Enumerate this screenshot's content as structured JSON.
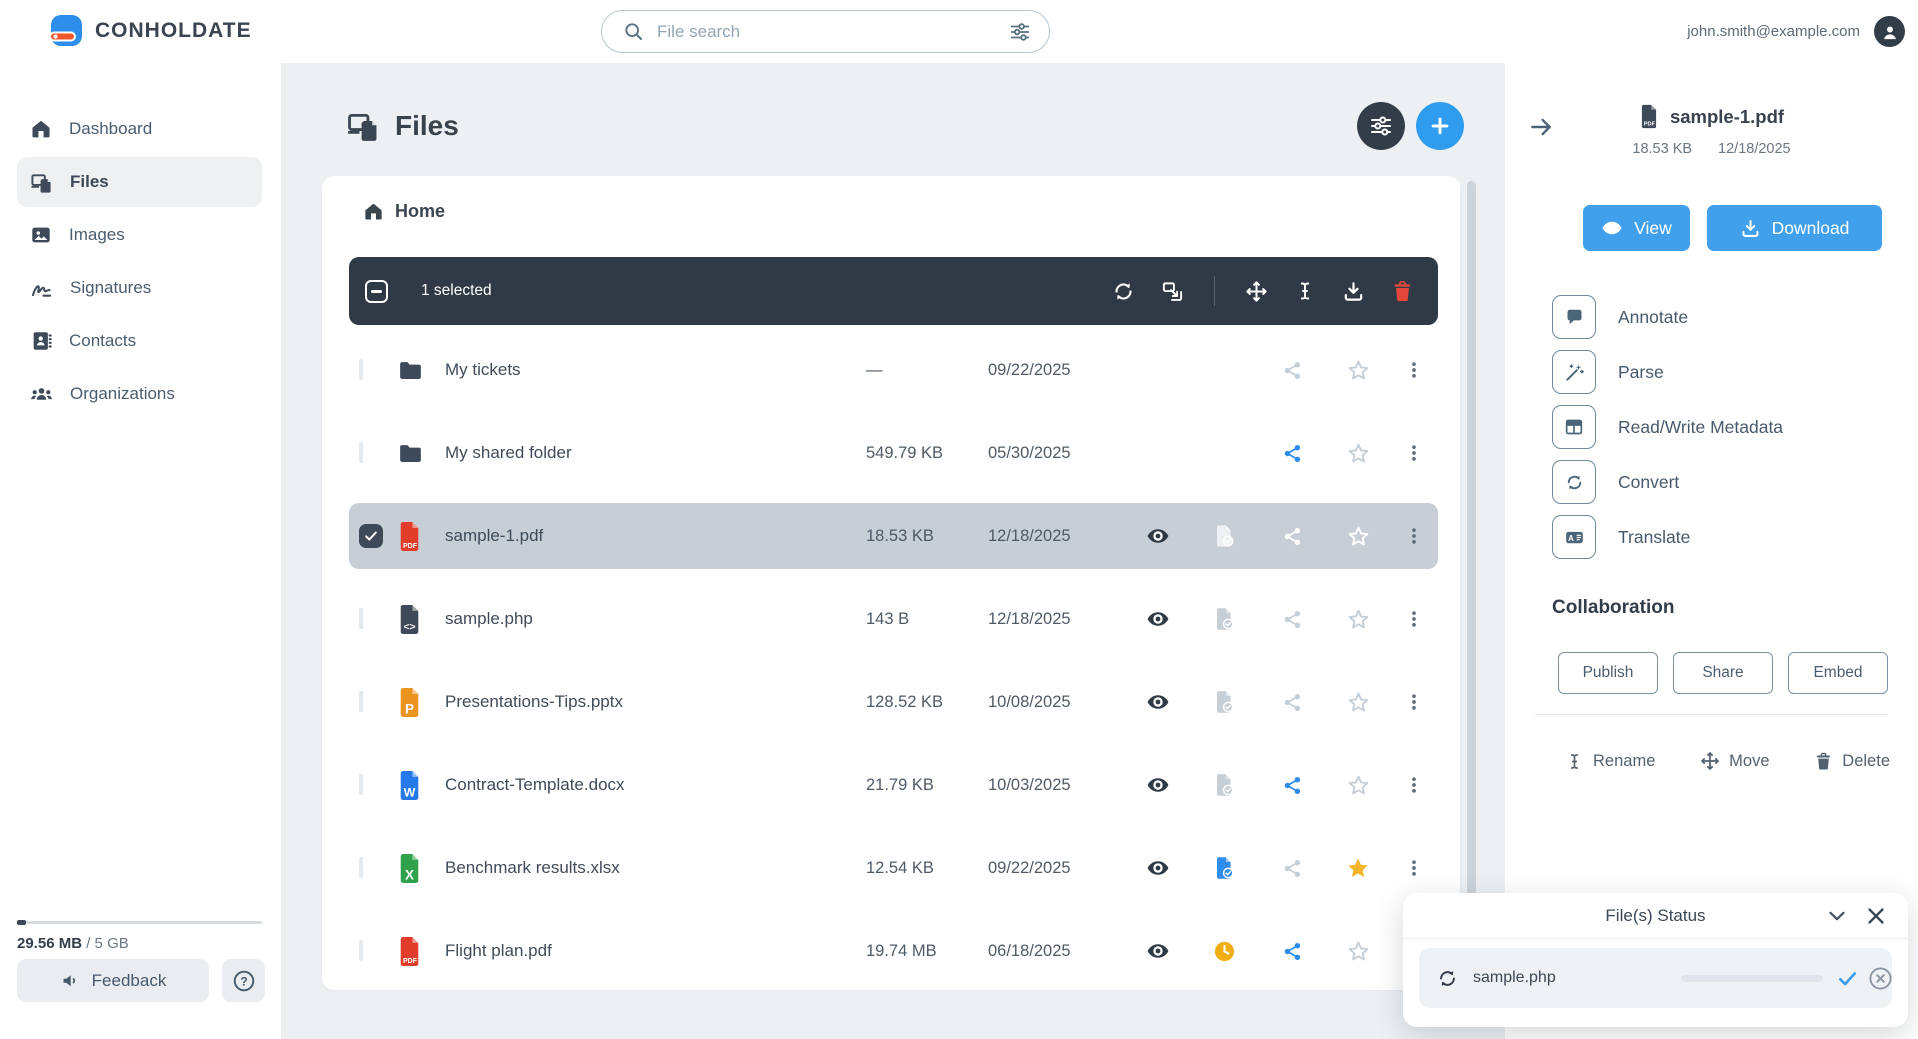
{
  "topbar": {
    "brand": "CONHOLDATE",
    "search_placeholder": "File search",
    "user_email": "john.smith@example.com"
  },
  "sidebar": {
    "items": [
      {
        "label": "Dashboard"
      },
      {
        "label": "Files"
      },
      {
        "label": "Images"
      },
      {
        "label": "Signatures"
      },
      {
        "label": "Contacts"
      },
      {
        "label": "Organizations"
      }
    ],
    "active_item": "Files",
    "storage": {
      "used": "29.56 MB",
      "total": "/ 5 GB"
    },
    "feedback_label": "Feedback",
    "help_glyph": "?"
  },
  "main": {
    "title": "Files",
    "breadcrumb_home": "Home",
    "toolbar": {
      "selected_label": "1 selected"
    },
    "rows": [
      {
        "name": "My tickets",
        "type": "folder",
        "size": "—",
        "date": "09/22/2025",
        "shared": false,
        "favorite": false,
        "selected": false
      },
      {
        "name": "My shared folder",
        "type": "folder",
        "size": "549.79 KB",
        "date": "05/30/2025",
        "shared": true,
        "favorite": false,
        "selected": false
      },
      {
        "name": "sample-1.pdf",
        "type": "pdf",
        "size": "18.53 KB",
        "date": "12/18/2025",
        "shared": false,
        "favorite": false,
        "selected": true
      },
      {
        "name": "sample.php",
        "type": "php",
        "size": "143 B",
        "date": "12/18/2025",
        "shared": false,
        "favorite": false,
        "selected": false
      },
      {
        "name": "Presentations-Tips.pptx",
        "type": "pptx",
        "size": "128.52 KB",
        "date": "10/08/2025",
        "shared": false,
        "favorite": false,
        "selected": false
      },
      {
        "name": "Contract-Template.docx",
        "type": "docx",
        "size": "21.79 KB",
        "date": "10/03/2025",
        "shared": true,
        "favorite": false,
        "selected": false
      },
      {
        "name": "Benchmark results.xlsx",
        "type": "xlsx",
        "size": "12.54 KB",
        "date": "09/22/2025",
        "shared": false,
        "favorite": true,
        "selected": false,
        "status": "processed"
      },
      {
        "name": "Flight plan.pdf",
        "type": "pdf",
        "size": "19.74 MB",
        "date": "06/18/2025",
        "shared": true,
        "favorite": false,
        "selected": false,
        "status": "pending"
      }
    ]
  },
  "details": {
    "file_name": "sample-1.pdf",
    "size": "18.53 KB",
    "date": "12/18/2025",
    "view_label": "View",
    "download_label": "Download",
    "actions": [
      "Annotate",
      "Parse",
      "Read/Write Metadata",
      "Convert",
      "Translate"
    ],
    "collaboration": {
      "title": "Collaboration",
      "buttons": [
        "Publish",
        "Share",
        "Embed"
      ]
    },
    "file_ops": [
      "Rename",
      "Move",
      "Delete"
    ]
  },
  "status_panel": {
    "title": "File(s) Status",
    "items": [
      {
        "name": "sample.php",
        "progress_percent": 100,
        "state": "completed"
      }
    ]
  },
  "icons": {
    "file_letters": {
      "pdf": "PDF",
      "php": "<>",
      "pptx": "P",
      "docx": "W",
      "xlsx": "X"
    },
    "translate_glyph": "A"
  },
  "colors": {
    "accent_blue": "#2f9cf0",
    "button_blue": "#41a0ec",
    "share_blue": "#2e8ceb",
    "toolbar_dark": "#2f3a46",
    "selected_row": "#c7ced6",
    "star_yellow": "#f5b62e",
    "clock_yellow": "#f2ad12",
    "delete_red": "#e2473a",
    "pdf_red": "#e23c2b",
    "pptx_orange": "#e9941f",
    "docx_blue": "#2579e8",
    "xlsx_green": "#31a24c"
  }
}
